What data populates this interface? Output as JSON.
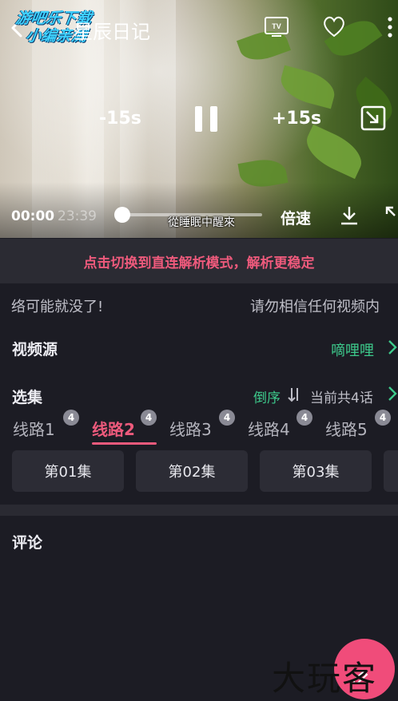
{
  "player": {
    "watermark_line1": "游吧乐下载",
    "watermark_line2": "小编亲测",
    "title": "星辰日记",
    "skip_back": "-15s",
    "skip_forward": "+15s",
    "current_time": "00:00",
    "total_time": "23:39",
    "progress": 0.02,
    "subtitle": "從睡眠中醒來",
    "speed_label": "倍速"
  },
  "banner": {
    "mode_text": "点击切换到直连解析模式，解析更稳定"
  },
  "marquee": {
    "left_text": "络可能就没了!",
    "right_text": "请勿相信任何视频内"
  },
  "source": {
    "label": "视频源",
    "value": "嘀哩哩"
  },
  "episodes": {
    "label": "选集",
    "order_label": "倒序",
    "count_text": "当前共4话",
    "lines": [
      {
        "label": "线路1",
        "badge": "4"
      },
      {
        "label": "线路2",
        "badge": "4"
      },
      {
        "label": "线路3",
        "badge": "4"
      },
      {
        "label": "线路4",
        "badge": "4"
      },
      {
        "label": "线路5",
        "badge": "4"
      }
    ],
    "items": [
      "第01集",
      "第02集",
      "第03集"
    ]
  },
  "comments": {
    "label": "评论"
  },
  "corner_mark": "大玩客",
  "colors": {
    "accent": "#ee5a7c",
    "green": "#3dc98b",
    "background": "#1c1c24"
  }
}
